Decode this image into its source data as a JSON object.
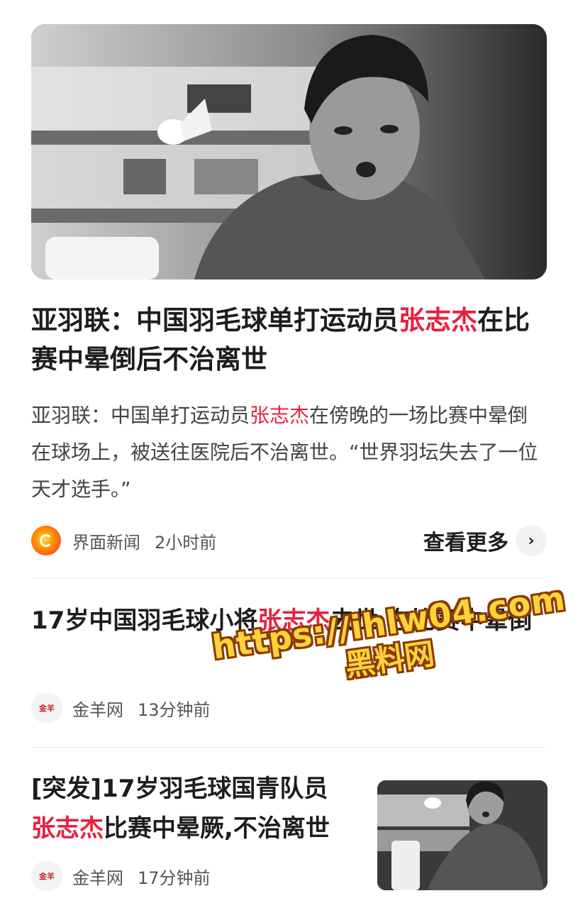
{
  "article1": {
    "headline_a": "亚羽联：中国羽毛球单打运动员",
    "headline_name": "张志杰",
    "headline_b": "在比赛中晕倒后不治离世",
    "summary_a": "亚羽联：中国单打运动员",
    "summary_name": "张志杰",
    "summary_b": "在傍晚的一场比赛中晕倒在球场上，被送往医院后不治离世。“世界羽坛失去了一位天才选手。”",
    "source": "界面新闻",
    "time": "2小时前",
    "more_label": "查看更多",
    "more_icon": "chevron-right-icon"
  },
  "article2": {
    "title_a": "17岁中国羽毛球小将",
    "title_name": "张志杰",
    "title_b": "去世,在比赛中晕倒",
    "source": "金羊网",
    "time": "13分钟前"
  },
  "article3": {
    "title_a": "[突发]17岁羽毛球国青队员",
    "title_name": "张志杰",
    "title_b": "比赛中晕厥,不治离世",
    "source": "金羊网",
    "time": "17分钟前"
  },
  "watermark": {
    "url": "https://ihlw04.com",
    "name": "黑料网"
  },
  "colors": {
    "highlight": "#e8203c",
    "text": "#1d1d1f",
    "watermark_fill": "#ffd23a"
  }
}
